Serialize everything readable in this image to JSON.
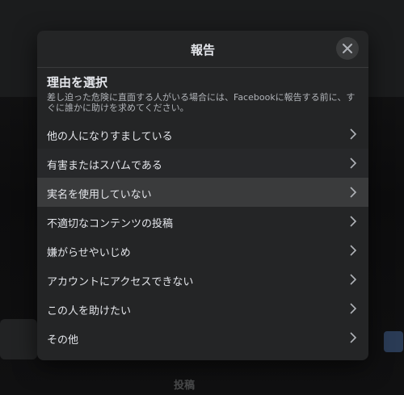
{
  "dialog": {
    "title": "報告",
    "heading": "理由を選択",
    "description": "差し迫った危険に直面する人がいる場合には、Facebookに報告する前に、すぐに誰かに助けを求めてください。",
    "options": [
      {
        "label": "他の人になりすましている"
      },
      {
        "label": "有害またはスパムである"
      },
      {
        "label": "実名を使用していない"
      },
      {
        "label": "不適切なコンテンツの投稿"
      },
      {
        "label": "嫌がらせやいじめ"
      },
      {
        "label": "アカウントにアクセスできない"
      },
      {
        "label": "この人を助けたい"
      },
      {
        "label": "その他"
      }
    ]
  },
  "background": {
    "bottom_label": "投稿"
  },
  "icons": {
    "close": "close-icon",
    "chevron": "chevron-right-icon"
  },
  "colors": {
    "dialog_bg": "#242526",
    "text_primary": "#e4e6eb",
    "text_secondary": "#b0b3b8",
    "hover_row": "#3a3b3c"
  }
}
